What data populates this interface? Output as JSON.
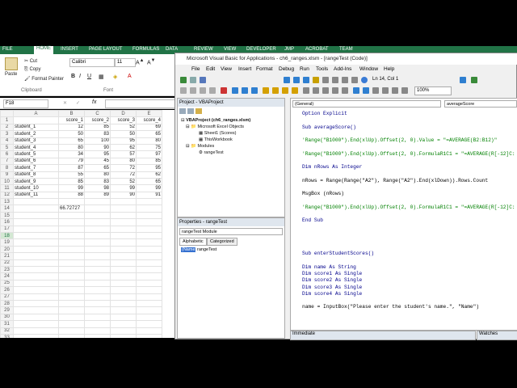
{
  "excel": {
    "tabs": [
      "FILE",
      "HOME",
      "INSERT",
      "PAGE LAYOUT",
      "FORMULAS",
      "DATA",
      "REVIEW",
      "VIEW",
      "DEVELOPER",
      "JMP",
      "ACROBAT",
      "TEAM"
    ],
    "clipboard": {
      "paste": "Paste",
      "cut": "Cut",
      "copy": "Copy",
      "format_painter": "Format Painter",
      "group": "Clipboard"
    },
    "font": {
      "name": "Calibri",
      "size": "11",
      "group": "Font"
    },
    "name_box": "F18",
    "fx": "fx",
    "columns": [
      "",
      "A",
      "B",
      "C",
      "D",
      "E"
    ],
    "rows": [
      [
        "1",
        "",
        "score_1",
        "score_2",
        "score_3",
        "score_4"
      ],
      [
        "2",
        "student_1",
        "12",
        "85",
        "52",
        "69"
      ],
      [
        "3",
        "student_2",
        "50",
        "83",
        "50",
        "65"
      ],
      [
        "4",
        "student_3",
        "65",
        "100",
        "95",
        "80"
      ],
      [
        "5",
        "student_4",
        "80",
        "90",
        "62",
        "75"
      ],
      [
        "6",
        "student_5",
        "34",
        "95",
        "57",
        "97"
      ],
      [
        "7",
        "student_6",
        "79",
        "45",
        "80",
        "85"
      ],
      [
        "8",
        "student_7",
        "87",
        "65",
        "72",
        "95"
      ],
      [
        "9",
        "student_8",
        "55",
        "80",
        "72",
        "62"
      ],
      [
        "10",
        "student_9",
        "85",
        "83",
        "52",
        "65"
      ],
      [
        "11",
        "student_10",
        "99",
        "98",
        "99",
        "99"
      ],
      [
        "12",
        "student_11",
        "88",
        "89",
        "90",
        "91"
      ],
      [
        "13",
        "",
        "",
        "",
        "",
        ""
      ],
      [
        "14",
        "",
        "66.72727",
        "",
        "",
        ""
      ],
      [
        "15",
        "",
        "",
        "",
        "",
        ""
      ],
      [
        "16",
        "",
        "",
        "",
        "",
        ""
      ],
      [
        "17",
        "",
        "",
        "",
        "",
        ""
      ],
      [
        "18",
        "",
        "",
        "",
        "",
        ""
      ],
      [
        "19",
        "",
        "",
        "",
        "",
        ""
      ],
      [
        "20",
        "",
        "",
        "",
        "",
        ""
      ],
      [
        "21",
        "",
        "",
        "",
        "",
        ""
      ],
      [
        "22",
        "",
        "",
        "",
        "",
        ""
      ],
      [
        "23",
        "",
        "",
        "",
        "",
        ""
      ],
      [
        "24",
        "",
        "",
        "",
        "",
        ""
      ],
      [
        "25",
        "",
        "",
        "",
        "",
        ""
      ],
      [
        "26",
        "",
        "",
        "",
        "",
        ""
      ],
      [
        "27",
        "",
        "",
        "",
        "",
        ""
      ],
      [
        "28",
        "",
        "",
        "",
        "",
        ""
      ],
      [
        "29",
        "",
        "",
        "",
        "",
        ""
      ],
      [
        "30",
        "",
        "",
        "",
        "",
        ""
      ],
      [
        "31",
        "",
        "",
        "",
        "",
        ""
      ],
      [
        "32",
        "",
        "",
        "",
        "",
        ""
      ],
      [
        "33",
        "",
        "",
        "",
        "",
        ""
      ]
    ]
  },
  "vbe": {
    "title": "Microsoft Visual Basic for Applications - ch6_ranges.xlsm - [rangeTest (Code)]",
    "menu": [
      "File",
      "Edit",
      "View",
      "Insert",
      "Format",
      "Debug",
      "Run",
      "Tools",
      "Add-Ins",
      "Window",
      "Help"
    ],
    "position": "Ln 14, Col 1",
    "zoom": "100%",
    "project": {
      "title": "Project - VBAProject",
      "root": "VBAProject (ch6_ranges.xlsm)",
      "excel_objects": "Microsoft Excel Objects",
      "sheet1": "Sheet1 (Scores)",
      "thisworkbook": "ThisWorkbook",
      "modules": "Modules",
      "module": "rangeTest"
    },
    "properties": {
      "title": "Properties - rangeTest",
      "dropdown": "rangeTest  Module",
      "tab_alpha": "Alphabetic",
      "tab_cat": "Categorized",
      "prop_name": "(Name)",
      "prop_value": "rangeTest"
    },
    "code": {
      "object": "(General)",
      "proc": "averageScore",
      "lines": [
        [
          "kw",
          "Option Explicit"
        ],
        [
          "",
          ""
        ],
        [
          "kw",
          "Sub averageScore()"
        ],
        [
          "",
          ""
        ],
        [
          "cm",
          "'Range(\"B1000\").End(xlUp).Offset(2, 0).Value = \"=AVERAGE(B2:B12)\""
        ],
        [
          "",
          ""
        ],
        [
          "cm",
          "'Range(\"B1000\").End(xlUp).Offset(2, 0).FormulaR1C1 = \"=AVERAGE(R[-12]C:"
        ],
        [
          "",
          ""
        ],
        [
          "kw",
          "Dim nRows As Integer"
        ],
        [
          "",
          ""
        ],
        [
          "",
          "nRows = Range(Range(\"A2\"), Range(\"A2\").End(xlDown)).Rows.Count"
        ],
        [
          "",
          ""
        ],
        [
          "",
          "MsgBox (nRows)"
        ],
        [
          "",
          ""
        ],
        [
          "cm",
          "'Range(\"B1000\").End(xlUp).Offset(2, 0).FormulaR1C1 = \"=AVERAGE(R[-12]C:"
        ],
        [
          "",
          ""
        ],
        [
          "kw",
          "End Sub"
        ],
        [
          "",
          ""
        ],
        [
          "",
          ""
        ],
        [
          "",
          ""
        ],
        [
          "",
          ""
        ],
        [
          "kw",
          "Sub enterStudentScores()"
        ],
        [
          "",
          ""
        ],
        [
          "kw",
          "Dim name As String"
        ],
        [
          "kw",
          "Dim score1 As Single"
        ],
        [
          "kw",
          "Dim score2 As Single"
        ],
        [
          "kw",
          "Dim score3 As Single"
        ],
        [
          "kw",
          "Dim score4 As Single"
        ],
        [
          "",
          ""
        ],
        [
          "",
          "name = InputBox(\"Please enter the student's name.\", \"Name\")"
        ]
      ]
    },
    "immediate": "Immediate",
    "watches": "Watches"
  }
}
